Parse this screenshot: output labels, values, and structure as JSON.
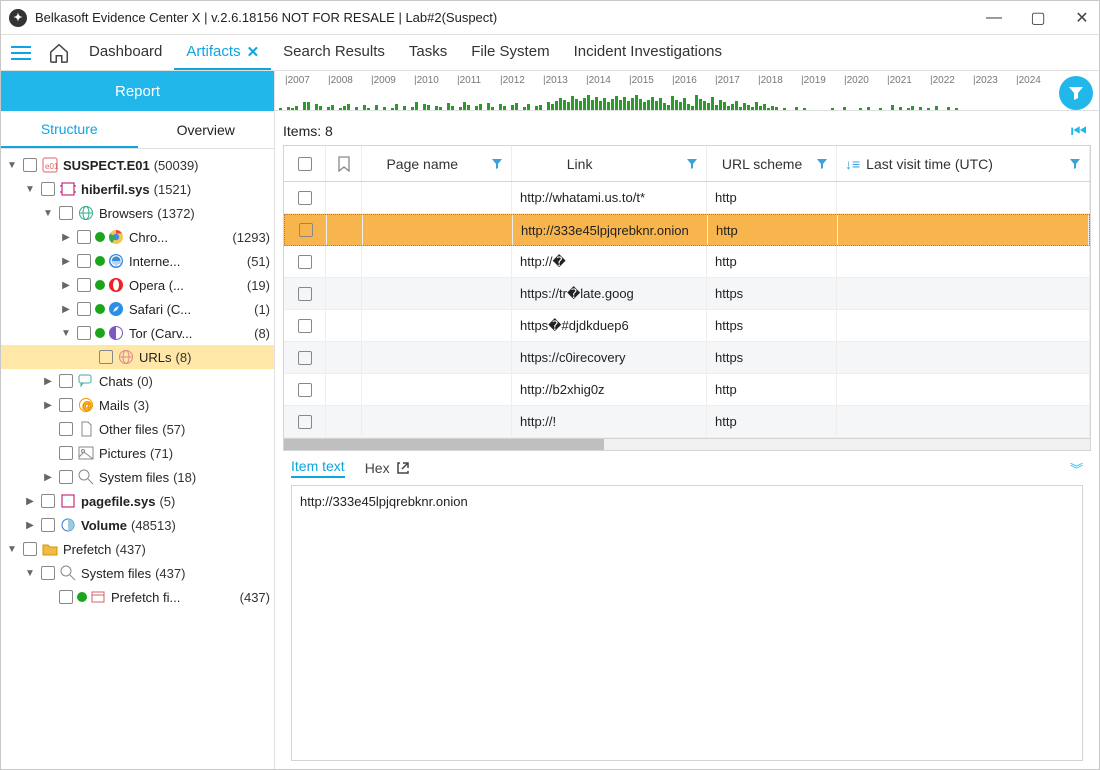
{
  "title": "Belkasoft Evidence Center X | v.2.6.18156 NOT FOR RESALE | Lab#2(Suspect)",
  "main_tabs": {
    "dashboard": "Dashboard",
    "artifacts": "Artifacts",
    "search": "Search Results",
    "tasks": "Tasks",
    "fs": "File System",
    "incident": "Incident Investigations"
  },
  "report_btn": "Report",
  "left_tabs": {
    "structure": "Structure",
    "overview": "Overview"
  },
  "tree": {
    "suspect": {
      "label": "SUSPECT.E01",
      "count": "(50039)"
    },
    "hiberfil": {
      "label": "hiberfil.sys",
      "count": "(1521)"
    },
    "browsers": {
      "label": "Browsers",
      "count": "(1372)"
    },
    "chrome": {
      "label": "Chro...",
      "count": "(1293)"
    },
    "ie": {
      "label": "Interne...",
      "count": "(51)"
    },
    "opera": {
      "label": "Opera (...",
      "count": "(19)"
    },
    "safari": {
      "label": "Safari (C...",
      "count": "(1)"
    },
    "tor": {
      "label": "Tor (Carv...",
      "count": "(8)"
    },
    "urls": {
      "label": "URLs",
      "count": "(8)"
    },
    "chats": {
      "label": "Chats",
      "count": "(0)"
    },
    "mails": {
      "label": "Mails",
      "count": "(3)"
    },
    "otherfiles": {
      "label": "Other files",
      "count": "(57)"
    },
    "pictures": {
      "label": "Pictures",
      "count": "(71)"
    },
    "sysfiles1": {
      "label": "System files",
      "count": "(18)"
    },
    "pagefile": {
      "label": "pagefile.sys",
      "count": "(5)"
    },
    "volume": {
      "label": "Volume",
      "count": "(48513)"
    },
    "prefetch": {
      "label": "Prefetch",
      "count": "(437)"
    },
    "sysfiles2": {
      "label": "System files",
      "count": "(437)"
    },
    "prefetchfiles": {
      "label": "Prefetch fi...",
      "count": "(437)"
    }
  },
  "timeline_years": [
    "2007",
    "2008",
    "2009",
    "2010",
    "2011",
    "2012",
    "2013",
    "2014",
    "2015",
    "2016",
    "2017",
    "2018",
    "2019",
    "2020",
    "2021",
    "2022",
    "2023",
    "2024"
  ],
  "items_header": "Items: 8",
  "columns": {
    "pagename": "Page name",
    "link": "Link",
    "urlscheme": "URL scheme",
    "lastvisit": "Last visit time (UTC)"
  },
  "rows": [
    {
      "link": "http://whatami.us.to/t*",
      "scheme": "http"
    },
    {
      "link": "http://333e45lpjqrebknr.onion",
      "scheme": "http",
      "selected": true
    },
    {
      "link": "http://�",
      "scheme": "http"
    },
    {
      "link": "https://tr�late.goog",
      "scheme": "https"
    },
    {
      "link": "https�#djdkduep6",
      "scheme": "https"
    },
    {
      "link": "https://c0irecovery",
      "scheme": "https"
    },
    {
      "link": "http://b2xhig0z",
      "scheme": "http"
    },
    {
      "link": "http://!",
      "scheme": "http"
    }
  ],
  "detail_tabs": {
    "itemtext": "Item text",
    "hex": "Hex"
  },
  "detail_body": "http://333e45lpjqrebknr.onion"
}
